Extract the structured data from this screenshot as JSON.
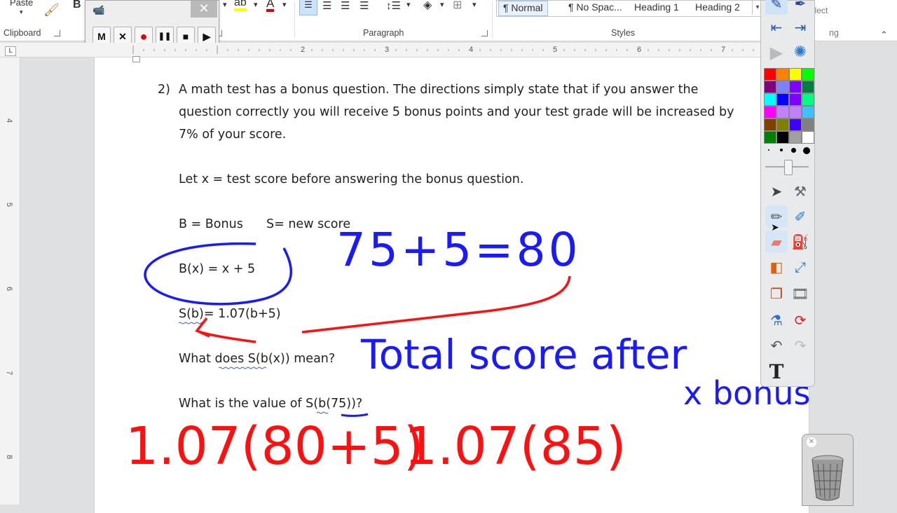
{
  "ribbon": {
    "paste_label": "Paste",
    "bold_label": "B",
    "font_color_letter": "A",
    "select_label": "Select",
    "groups": {
      "clipboard": "Clipboard",
      "paragraph": "Paragraph",
      "styles": "Styles",
      "editing_fragment": "ng"
    },
    "styles": [
      "¶ Normal",
      "¶ No Spac...",
      "Heading 1",
      "Heading 2"
    ]
  },
  "recorder": {
    "close_glyph": "✕",
    "buttons": [
      "M",
      "✕",
      "●",
      "❚❚",
      "■",
      "▶"
    ]
  },
  "ruler": {
    "h_numbers": [
      "2",
      "3",
      "4",
      "5",
      "6",
      "7"
    ],
    "v_numbers": [
      "4",
      "5",
      "6",
      "7",
      "8"
    ],
    "corner": "L"
  },
  "document": {
    "q_number": "2)",
    "q_line1": "A math test has a bonus question.  The directions simply state that if you answer the",
    "q_line2": "question correctly you will receive 5 bonus points and your test grade will be increased by",
    "q_line3": "7% of your score.",
    "let_line": "Let x = test score before answering the bonus question.",
    "defs_b": "B = Bonus",
    "defs_s": "S= new score",
    "eq_b": "B(x) = x + 5",
    "eq_s": "S(b)=  1.07(b+5)",
    "question1": "What does  S(b(x)) mean?",
    "question2": "What is the value of S(b(75))?"
  },
  "ink": {
    "blue_calc": "75+5=80",
    "blue_total": "Total score after",
    "blue_xbonus": "x bonus",
    "red_calc1": "1.07(80+5)",
    "red_calc2": "1.07(85)"
  },
  "palette": {
    "colors": [
      "#ff0000",
      "#ff8000",
      "#ffff00",
      "#00ff00",
      "#800080",
      "#8080ff",
      "#8000ff",
      "#008040",
      "#00ffff",
      "#0000ff",
      "#8000ff",
      "#00ff80",
      "#ff00ff",
      "#c080ff",
      "#c080ff",
      "#40c0ff",
      "#804000",
      "#808000",
      "#4000ff",
      "#808080",
      "#008000",
      "#000000",
      "#a0a0a0",
      "#ffffff"
    ],
    "text_tool": "T"
  },
  "trash": {
    "close_glyph": "✕"
  },
  "colors": {
    "ink_blue": "#1a1aff",
    "ink_red": "#ff1010"
  }
}
